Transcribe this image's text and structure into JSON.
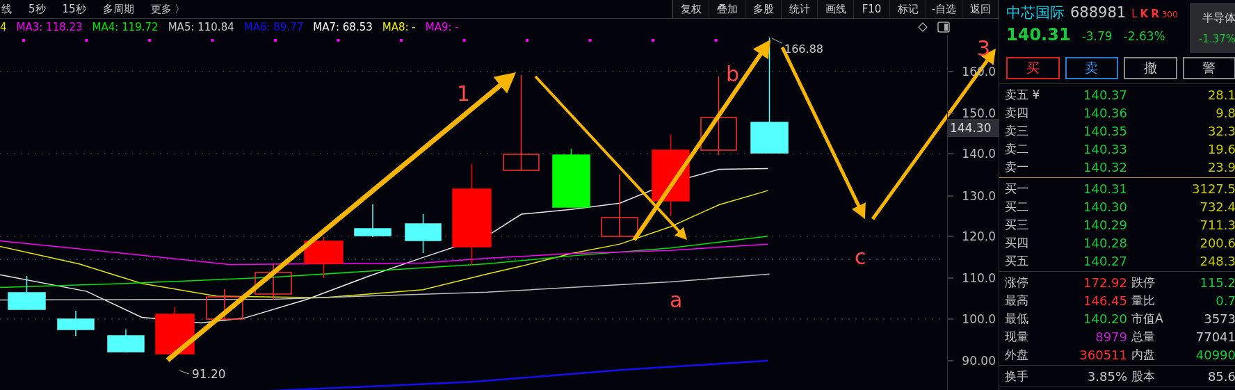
{
  "toolbar": {
    "period_tabs": [
      "线",
      "5秒",
      "15秒",
      "多周期",
      "更多 〉"
    ],
    "buttons": [
      "复权",
      "叠加",
      "多股",
      "统计",
      "画线",
      "F10",
      "标记",
      "-自选",
      "返回"
    ]
  },
  "ma_legend": [
    {
      "label": "4",
      "color": "#e6e600"
    },
    {
      "label": "MA3: 118.23",
      "color": "#ff00ff"
    },
    {
      "label": "MA4: 119.72",
      "color": "#00e600"
    },
    {
      "label": "MA5: 110.84",
      "color": "#c8c8c8"
    },
    {
      "label": "MA6: 89.77",
      "color": "#1010f0"
    },
    {
      "label": "MA7: 68.53",
      "color": "#ffffff"
    },
    {
      "label": "MA8: -",
      "color": "#f0f000"
    },
    {
      "label": "MA9: -",
      "color": "#ff00ff"
    }
  ],
  "chart": {
    "price_axis": [
      "160.0",
      "150.0",
      "140.0",
      "130.0",
      "120.0",
      "110.0",
      "100.0",
      "90.00"
    ],
    "current_price_tag": "144.30",
    "high_marker": "166.88",
    "low_marker": "91.20",
    "wave_labels": [
      "1",
      "b",
      "3",
      "a",
      "c"
    ]
  },
  "quote": {
    "name": "中芯国际",
    "code": "688981",
    "flags": [
      "L",
      "K",
      "R",
      "300"
    ],
    "price": "140.31",
    "change": "-3.79",
    "change_pct": "-2.63%",
    "sector": {
      "name": "半导体",
      "change": "-1.37%"
    }
  },
  "trade_buttons": [
    {
      "label": "买",
      "kind": "buy"
    },
    {
      "label": "卖",
      "kind": "sell"
    },
    {
      "label": "撤",
      "kind": "cancel"
    },
    {
      "label": "警",
      "kind": "alert"
    }
  ],
  "asks": [
    {
      "label": "卖五 ¥",
      "price": "140.37",
      "volume": "28.1"
    },
    {
      "label": "卖四",
      "price": "140.36",
      "volume": "9.8"
    },
    {
      "label": "卖三",
      "price": "140.35",
      "volume": "32.3"
    },
    {
      "label": "卖二",
      "price": "140.33",
      "volume": "19.6"
    },
    {
      "label": "卖一",
      "price": "140.32",
      "volume": "23.9"
    }
  ],
  "bids": [
    {
      "label": "买一",
      "price": "140.31",
      "volume": "3127.5"
    },
    {
      "label": "买二",
      "price": "140.30",
      "volume": "732.4"
    },
    {
      "label": "买三",
      "price": "140.29",
      "volume": "711.3"
    },
    {
      "label": "买四",
      "price": "140.28",
      "volume": "200.6"
    },
    {
      "label": "买五",
      "price": "140.27",
      "volume": "248.3"
    }
  ],
  "stats": [
    {
      "left": {
        "label": "涨停",
        "value": "172.92",
        "color": "#ff3030"
      },
      "right": {
        "label": "跌停",
        "value": "115.2",
        "color": "#1ec83c"
      }
    },
    {
      "left": {
        "label": "最高",
        "value": "146.45",
        "color": "#ff3030"
      },
      "right": {
        "label": "量比",
        "value": "0.7",
        "color": "#1ec83c"
      }
    },
    {
      "left": {
        "label": "最低",
        "value": "140.20",
        "color": "#1ec83c"
      },
      "right": {
        "label": "市值A",
        "value": "3573",
        "color": "#c8c8c8"
      }
    },
    {
      "left": {
        "label": "现量",
        "value": "8979",
        "color": "#c020d0"
      },
      "right": {
        "label": "总量",
        "value": "77041",
        "color": "#c8c8c8"
      }
    },
    {
      "left": {
        "label": "外盘",
        "value": "360511",
        "color": "#ff3030"
      },
      "right": {
        "label": "内盘",
        "value": "40990",
        "color": "#1ec83c"
      }
    }
  ],
  "extra": [
    {
      "left": {
        "label": "换手",
        "value": "3.85%",
        "color": "#c8c8c8"
      },
      "right": {
        "label": "股本",
        "value": "85.6",
        "color": "#c8c8c8"
      }
    }
  ]
}
